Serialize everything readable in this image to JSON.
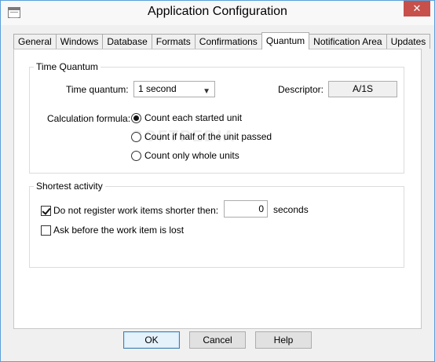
{
  "window": {
    "title": "Application Configuration",
    "close_glyph": "✕"
  },
  "tabs": [
    {
      "label": "General"
    },
    {
      "label": "Windows"
    },
    {
      "label": "Database"
    },
    {
      "label": "Formats"
    },
    {
      "label": "Confirmations"
    },
    {
      "label": "Quantum",
      "active": true
    },
    {
      "label": "Notification Area"
    },
    {
      "label": "Updates"
    }
  ],
  "time_quantum": {
    "group_label": "Time Quantum",
    "quantum_label": "Time quantum:",
    "quantum_value": "1 second",
    "descriptor_label": "Descriptor:",
    "descriptor_value": "A/1S",
    "formula_label": "Calculation formula:",
    "options": [
      {
        "label": "Count each started unit",
        "selected": true
      },
      {
        "label": "Count if half of the unit passed",
        "selected": false
      },
      {
        "label": "Count only whole units",
        "selected": false
      }
    ]
  },
  "shortest_activity": {
    "group_label": "Shortest activity",
    "dont_register_label": "Do not register work items shorter then:",
    "dont_register_checked": true,
    "seconds_value": "0",
    "seconds_unit": "seconds",
    "ask_before_label": "Ask before the work item is lost",
    "ask_before_checked": false
  },
  "buttons": {
    "ok": "OK",
    "cancel": "Cancel",
    "help": "Help"
  },
  "watermark": "SOFTPEDIA"
}
